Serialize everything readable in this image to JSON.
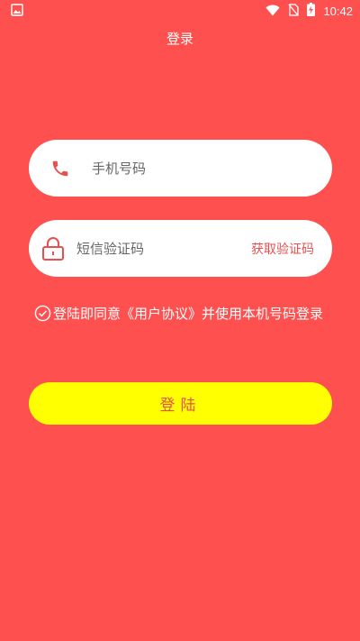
{
  "status_bar": {
    "time": "10:42",
    "icons": [
      "image-icon",
      "wifi-icon",
      "no-sim-icon",
      "battery-charging-icon"
    ]
  },
  "header": {
    "title": "登录"
  },
  "phone_input": {
    "placeholder": "手机号码",
    "icon": "phone-icon"
  },
  "code_input": {
    "placeholder": "短信验证码",
    "icon": "lock-icon",
    "get_code_label": "获取验证码"
  },
  "agreement": {
    "text": "登陆即同意《用户协议》并使用本机号码登录",
    "icon": "check-circle-icon"
  },
  "login_button": {
    "label": "登陆"
  },
  "colors": {
    "background": "#FF5050",
    "accent": "#E85050",
    "button": "#FFFF00",
    "input_bg": "#FFFFFF"
  }
}
